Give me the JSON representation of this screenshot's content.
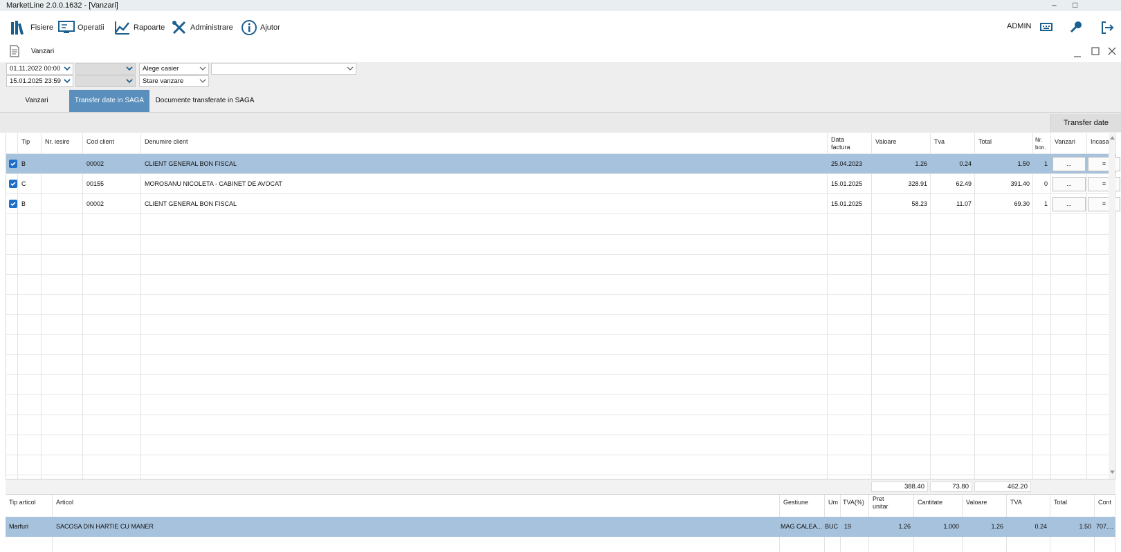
{
  "window": {
    "title": "MarketLine 2.0.0.1632 - [Vanzari]",
    "min_glyph": "–",
    "max_glyph": "□"
  },
  "menu": {
    "items": [
      {
        "label": "Fisiere",
        "icon": "books-icon"
      },
      {
        "label": "Operatii",
        "icon": "monitor-icon"
      },
      {
        "label": "Rapoarte",
        "icon": "chart-icon"
      },
      {
        "label": "Administrare",
        "icon": "tools-icon"
      },
      {
        "label": "Ajutor",
        "icon": "info-icon"
      }
    ],
    "user": "ADMIN",
    "accent": "#1b5f8f"
  },
  "document": {
    "title": "Vanzari"
  },
  "filters": {
    "date_from": "01.11.2022 00:00",
    "date_to": "15.01.2025 23:59",
    "cashier": "Alege casier",
    "sale_state": "Stare vanzare",
    "empty1": "",
    "empty2": "",
    "wide": ""
  },
  "tabs": [
    {
      "label": "Vanzari",
      "active": false
    },
    {
      "label": "Transfer date in SAGA",
      "active": true
    },
    {
      "label": "Documente transferate in SAGA",
      "active": false
    }
  ],
  "actions": {
    "transfer": "Transfer date"
  },
  "grid": {
    "headers": {
      "tip": "Tip",
      "nr_iesire": "Nr. iesire",
      "cod_client": "Cod client",
      "denumire": "Denumire client",
      "data_factura": "Data factura",
      "valoare": "Valoare",
      "tva": "Tva",
      "total": "Total",
      "nr_bon": "Nr. bon.",
      "vanzari": "Vanzari",
      "incasari": "Incasari"
    },
    "rows": [
      {
        "tip": "B",
        "nr_iesire": "",
        "cod_client": "00002",
        "denumire": "CLIENT GENERAL BON FISCAL",
        "data": "25.04.2023",
        "valoare": "1.26",
        "tva": "0.24",
        "total": "1.50",
        "nr_bon": "1",
        "vanzari_btn": "...",
        "incasari_btn": "≡"
      },
      {
        "tip": "C",
        "nr_iesire": "",
        "cod_client": "00155",
        "denumire": "MOROSANU NICOLETA - CABINET DE AVOCAT",
        "data": "15.01.2025",
        "valoare": "328.91",
        "tva": "62.49",
        "total": "391.40",
        "nr_bon": "0",
        "vanzari_btn": "...",
        "incasari_btn": "≡"
      },
      {
        "tip": "B",
        "nr_iesire": "",
        "cod_client": "00002",
        "denumire": "CLIENT GENERAL BON FISCAL",
        "data": "15.01.2025",
        "valoare": "58.23",
        "tva": "11.07",
        "total": "69.30",
        "nr_bon": "1",
        "vanzari_btn": "...",
        "incasari_btn": "≡"
      }
    ],
    "totals": {
      "valoare": "388.40",
      "tva": "73.80",
      "total": "462.20"
    },
    "selected_color": "#a7c2dc"
  },
  "detail": {
    "headers": {
      "tip_articol": "Tip articol",
      "articol": "Articol",
      "gestiune": "Gestiune",
      "um": "Um",
      "tva_pct": "TVA(%)",
      "pret_unitar": "Pret unitar",
      "cantitate": "Cantitate",
      "valoare": "Valoare",
      "tva": "TVA",
      "total": "Total",
      "cont": "Cont"
    },
    "row": {
      "tip_articol": "Marfuri",
      "articol": "SACOSA DIN HARTIE CU MANER",
      "gestiune": "MAG CALEA...",
      "um": "BUC",
      "tva_pct": "19",
      "pret_unitar": "1.26",
      "cantitate": "1.000",
      "valoare": "1.26",
      "tva": "0.24",
      "total": "1.50",
      "cont": "707...."
    }
  }
}
